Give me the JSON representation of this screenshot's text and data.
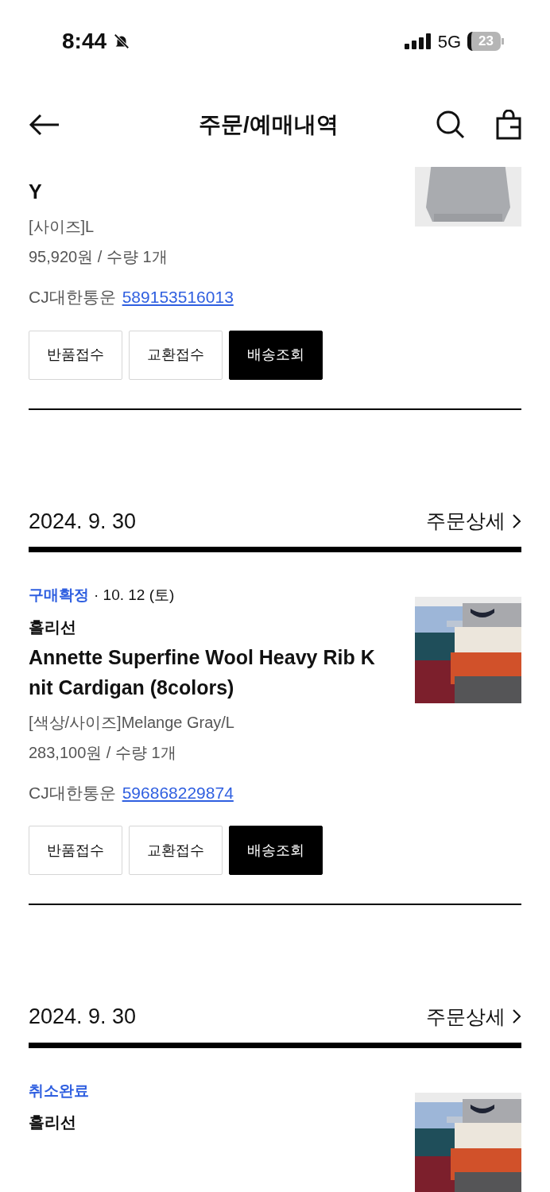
{
  "status_bar": {
    "time": "8:44",
    "network": "5G",
    "battery": "23"
  },
  "header": {
    "title": "주문/예매내역"
  },
  "orders": [
    {
      "title": "Y",
      "option": "[사이즈]L",
      "price": "95,920원 / 수량 1개",
      "courier": "CJ대한통운",
      "tracking": "589153516013",
      "buttons": [
        {
          "label": "반품접수",
          "kind": "outline"
        },
        {
          "label": "교환접수",
          "kind": "outline"
        },
        {
          "label": "배송조회",
          "kind": "filled"
        }
      ]
    },
    {
      "date": "2024. 9. 30",
      "detail_link": "주문상세",
      "status": "구매확정",
      "separator": "·",
      "status_date": "10. 12 (토)",
      "brand": "홀리선",
      "title": "Annette Superfine Wool Heavy Rib Knit Cardigan (8colors)",
      "option": "[색상/사이즈]Melange Gray/L",
      "price": "283,100원 / 수량 1개",
      "courier": "CJ대한통운",
      "tracking": "596868229874",
      "buttons": [
        {
          "label": "반품접수",
          "kind": "outline"
        },
        {
          "label": "교환접수",
          "kind": "outline"
        },
        {
          "label": "배송조회",
          "kind": "filled"
        }
      ]
    },
    {
      "date": "2024. 9. 30",
      "detail_link": "주문상세",
      "status": "취소완료",
      "brand": "홀리선"
    }
  ]
}
